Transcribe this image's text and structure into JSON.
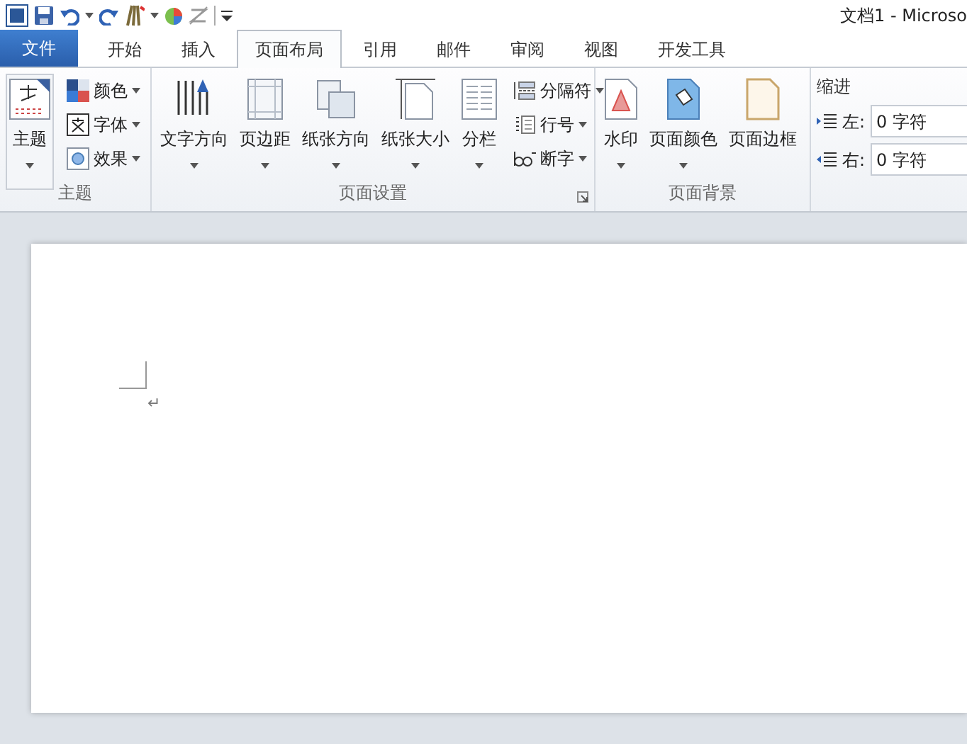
{
  "title_bar": {
    "title": "文档1 - Microso"
  },
  "tabs": [
    {
      "label": "文件",
      "kind": "file",
      "selected": false
    },
    {
      "label": "开始",
      "kind": "tab",
      "selected": false
    },
    {
      "label": "插入",
      "kind": "tab",
      "selected": false
    },
    {
      "label": "页面布局",
      "kind": "tab",
      "selected": true
    },
    {
      "label": "引用",
      "kind": "tab",
      "selected": false
    },
    {
      "label": "邮件",
      "kind": "tab",
      "selected": false
    },
    {
      "label": "审阅",
      "kind": "tab",
      "selected": false
    },
    {
      "label": "视图",
      "kind": "tab",
      "selected": false
    },
    {
      "label": "开发工具",
      "kind": "tab",
      "selected": false
    }
  ],
  "ribbon_groups": [
    {
      "kind": "buttons",
      "label": "主题",
      "launcher": false,
      "large": [
        {
          "label": "主题",
          "dropdown": true
        }
      ],
      "small": [
        {
          "label": "颜色",
          "dropdown": true
        },
        {
          "label": "字体",
          "dropdown": true
        },
        {
          "label": "效果",
          "dropdown": true
        }
      ]
    },
    {
      "kind": "buttons",
      "label": "页面设置",
      "launcher": true,
      "large": [
        {
          "label": "文字方向",
          "dropdown": true
        },
        {
          "label": "页边距",
          "dropdown": true
        },
        {
          "label": "纸张方向",
          "dropdown": true
        },
        {
          "label": "纸张大小",
          "dropdown": true
        },
        {
          "label": "分栏",
          "dropdown": true
        }
      ],
      "small": [
        {
          "label": "分隔符",
          "dropdown": true
        },
        {
          "label": "行号",
          "dropdown": true
        },
        {
          "label": "断字",
          "dropdown": true
        }
      ]
    },
    {
      "kind": "buttons",
      "label": "页面背景",
      "launcher": false,
      "large": [
        {
          "label": "水印",
          "dropdown": true
        },
        {
          "label": "页面颜色",
          "dropdown": true
        },
        {
          "label": "页面边框",
          "dropdown": false
        }
      ]
    },
    {
      "kind": "fields",
      "title": "缩进",
      "fields": [
        {
          "label": "左:",
          "value": "0 字符"
        },
        {
          "label": "右:",
          "value": "0 字符"
        }
      ]
    }
  ],
  "document": {
    "paragraph_mark": "↵"
  }
}
